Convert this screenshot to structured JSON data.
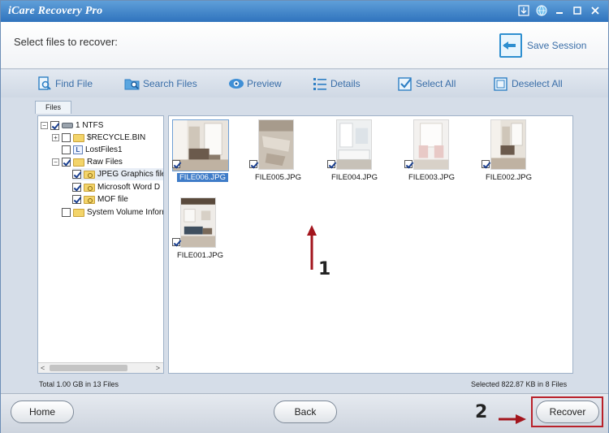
{
  "window": {
    "title": "iCare Recovery Pro"
  },
  "header": {
    "label": "Select files to recover:",
    "save_session": "Save Session"
  },
  "toolbar": {
    "find_file": "Find File",
    "search_files": "Search Files",
    "preview": "Preview",
    "details": "Details",
    "select_all": "Select All",
    "deselect_all": "Deselect All"
  },
  "tabs": {
    "files": "Files"
  },
  "tree": {
    "items": [
      {
        "label": "1 NTFS",
        "checked": true
      },
      {
        "label": "$RECYCLE.BIN",
        "checked": false
      },
      {
        "label": "LostFiles1",
        "checked": false
      },
      {
        "label": "Raw Files",
        "checked": true
      },
      {
        "label": "JPEG Graphics file",
        "checked": true
      },
      {
        "label": "Microsoft Word D",
        "checked": true
      },
      {
        "label": "MOF file",
        "checked": true
      },
      {
        "label": "System Volume Inforr",
        "checked": false
      }
    ]
  },
  "files": {
    "items": [
      {
        "name": "FILE006.JPG",
        "checked": true,
        "selected": true
      },
      {
        "name": "FILE005.JPG",
        "checked": true,
        "selected": false
      },
      {
        "name": "FILE004.JPG",
        "checked": true,
        "selected": false
      },
      {
        "name": "FILE003.JPG",
        "checked": true,
        "selected": false
      },
      {
        "name": "FILE002.JPG",
        "checked": true,
        "selected": false
      },
      {
        "name": "FILE001.JPG",
        "checked": true,
        "selected": false
      }
    ]
  },
  "annotations": {
    "step1": "1",
    "step2": "2"
  },
  "status": {
    "total": "Total 1.00 GB in 13 Files",
    "selected": "Selected 822.87 KB in 8 Files"
  },
  "buttons": {
    "home": "Home",
    "back": "Back",
    "recover": "Recover"
  },
  "colors": {
    "accent": "#3a6ea8",
    "title_bar": "#2f73bd",
    "highlight": "#b9212a"
  }
}
